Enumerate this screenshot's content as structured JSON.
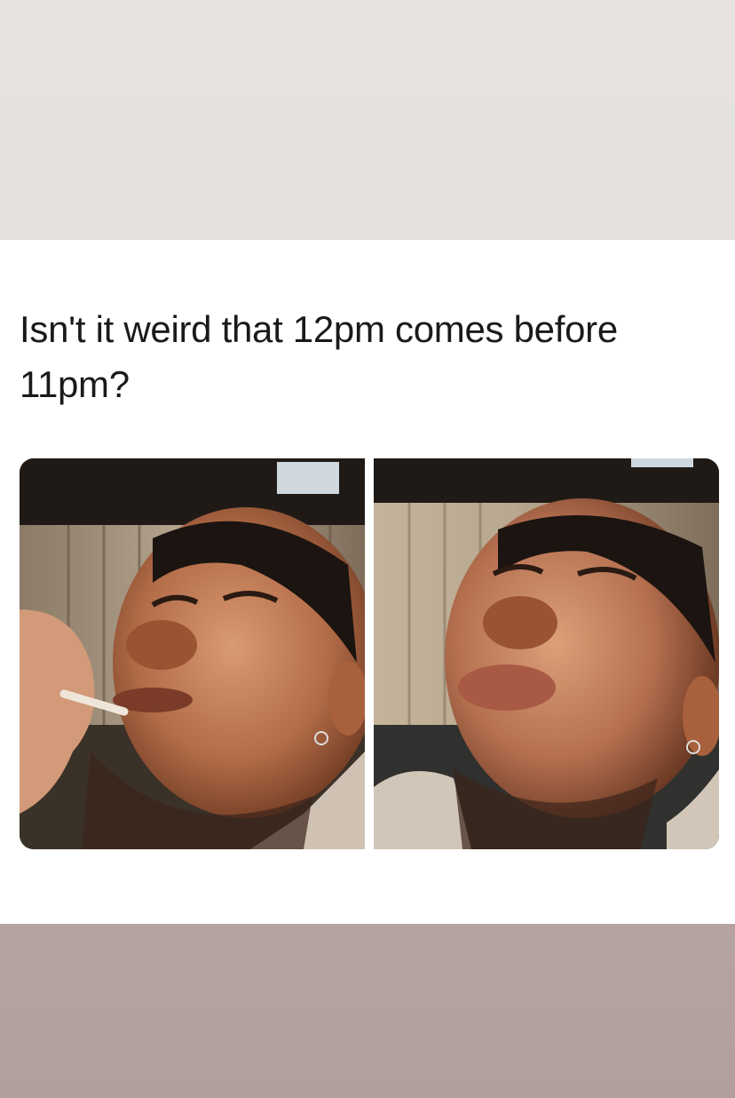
{
  "story": {
    "caption": "Isn't it weird that 12pm comes before 11pm?",
    "colors": {
      "top_band": "#e5e2df",
      "card": "#ffffff",
      "bottom_band": "#b3a29e",
      "text": "#1a1a1a"
    },
    "panels": [
      {
        "description_icon": "man-smoking-photo"
      },
      {
        "description_icon": "man-looking-up-photo"
      }
    ]
  }
}
